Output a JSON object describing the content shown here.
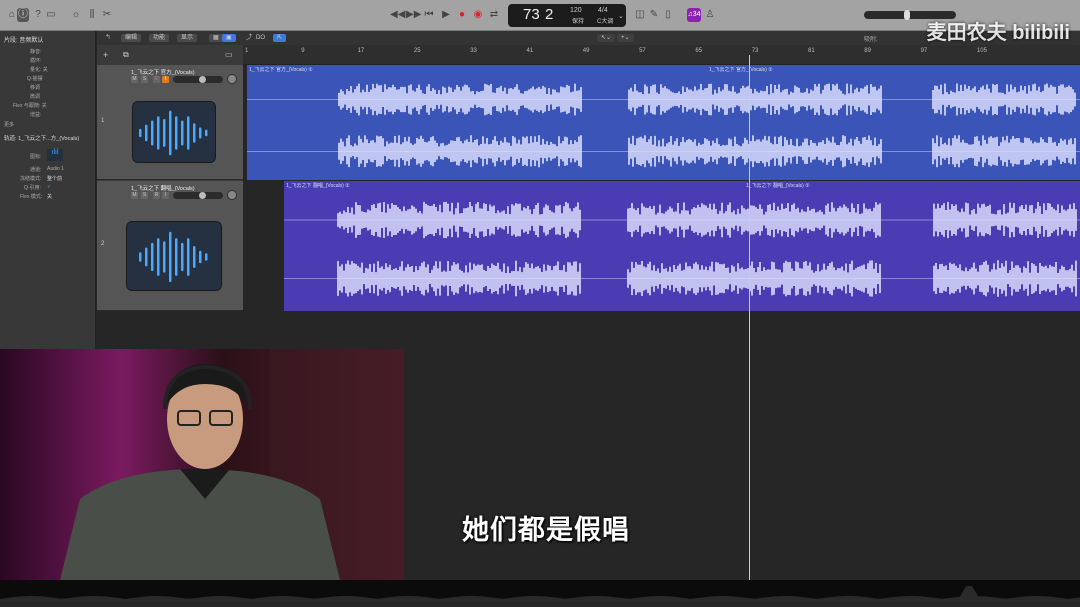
{
  "toolbar": {
    "lcd_bar": "73",
    "lcd_beat": "2",
    "tempo": "120",
    "time_sig": "4/4",
    "key": "C大调",
    "tempo_label": "保持",
    "badge": "♫34"
  },
  "inspector": {
    "region_title": "片段: 音频默认",
    "rows": [
      "静音:",
      "循环:",
      "量化: 关",
      "Q-摇摆",
      "移调",
      "微调",
      "Flex 与跟随: 关",
      "增益:",
      "更多"
    ],
    "track_title": "轨道: 1_飞云之下...方_(Vocals)",
    "icon_label": "图标:",
    "input_label": "通道:",
    "input_value": "Audio 1",
    "freeze_label": "冻结模式:",
    "freeze_value": "整个前",
    "q_label": "Q-引用:",
    "flex_label": "Flex 模式:",
    "flex_value": "关"
  },
  "header_menus": [
    "编辑",
    "功能",
    "显示"
  ],
  "ruler": [
    "1",
    "9",
    "17",
    "25",
    "33",
    "41",
    "49",
    "57",
    "65",
    "73",
    "81",
    "89",
    "97",
    "105"
  ],
  "tracks": [
    {
      "num": "1",
      "name": "1_飞云之下 官方_(Vocals)",
      "region_label": "1_飞云之下 官方_(Vocals) ②",
      "region_label2": "1_飞云之下 官方_(Vocals) ②",
      "color": "#3a54b8"
    },
    {
      "num": "2",
      "name": "1_飞云之下 翻唱_(Vocals)",
      "region_label": "1_飞云之下 翻唱_(Vocals) ②",
      "region_label2": "1_飞云之下 翻唱_(Vocals) ②",
      "color": "#4a3db4"
    }
  ],
  "msri": [
    "M",
    "S",
    "R",
    "I"
  ],
  "snap_label": "吸附:",
  "watermark": "麦田农夫 bilibili",
  "subtitle": "她们都是假唱"
}
